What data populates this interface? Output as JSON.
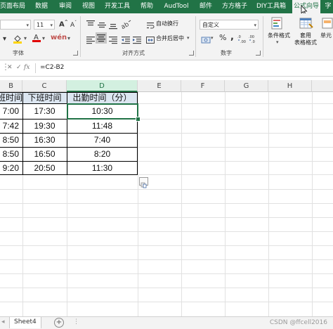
{
  "tabs": [
    {
      "label": "页面布局"
    },
    {
      "label": "数据"
    },
    {
      "label": "审阅"
    },
    {
      "label": "视图"
    },
    {
      "label": "开发工具"
    },
    {
      "label": "帮助"
    },
    {
      "label": "AudTool"
    },
    {
      "label": "邮件"
    },
    {
      "label": "方方格子"
    },
    {
      "label": "DIY工具箱"
    },
    {
      "label": "公式向导"
    },
    {
      "label": "字"
    }
  ],
  "ribbon": {
    "font_size": "11",
    "font_group_label": "字体",
    "align_group_label": "对齐方式",
    "number_group_label": "数字",
    "wrap_text_label": "自动换行",
    "merge_center_label": "合并后居中",
    "number_format": "自定义",
    "percent_symbol": "%",
    "comma_symbol": ",",
    "conditional_format_label": "条件格式",
    "table_format_label_1": "套用",
    "table_format_label_2": "表格格式",
    "cell_style_label": "单元"
  },
  "formula_bar": {
    "formula": "=C2-B2"
  },
  "columns": [
    "B",
    "C",
    "D",
    "E",
    "F",
    "G",
    "H"
  ],
  "table": {
    "headers": [
      "上班时间",
      "下班时间",
      "出勤时间（分）"
    ],
    "rows": [
      [
        "7:00",
        "17:30",
        "10:30"
      ],
      [
        "7:42",
        "19:30",
        "11:48"
      ],
      [
        "8:50",
        "16:30",
        "7:40"
      ],
      [
        "8:50",
        "16:50",
        "8:20"
      ],
      [
        "9:20",
        "20:50",
        "11:30"
      ]
    ]
  },
  "sheets": [
    {
      "label": "Sheet4"
    }
  ],
  "add_sheet_label": "+",
  "watermark": "CSDN @ffcell2016",
  "colors": {
    "accent": "#217346",
    "selection_header": "#d3f0e0"
  }
}
